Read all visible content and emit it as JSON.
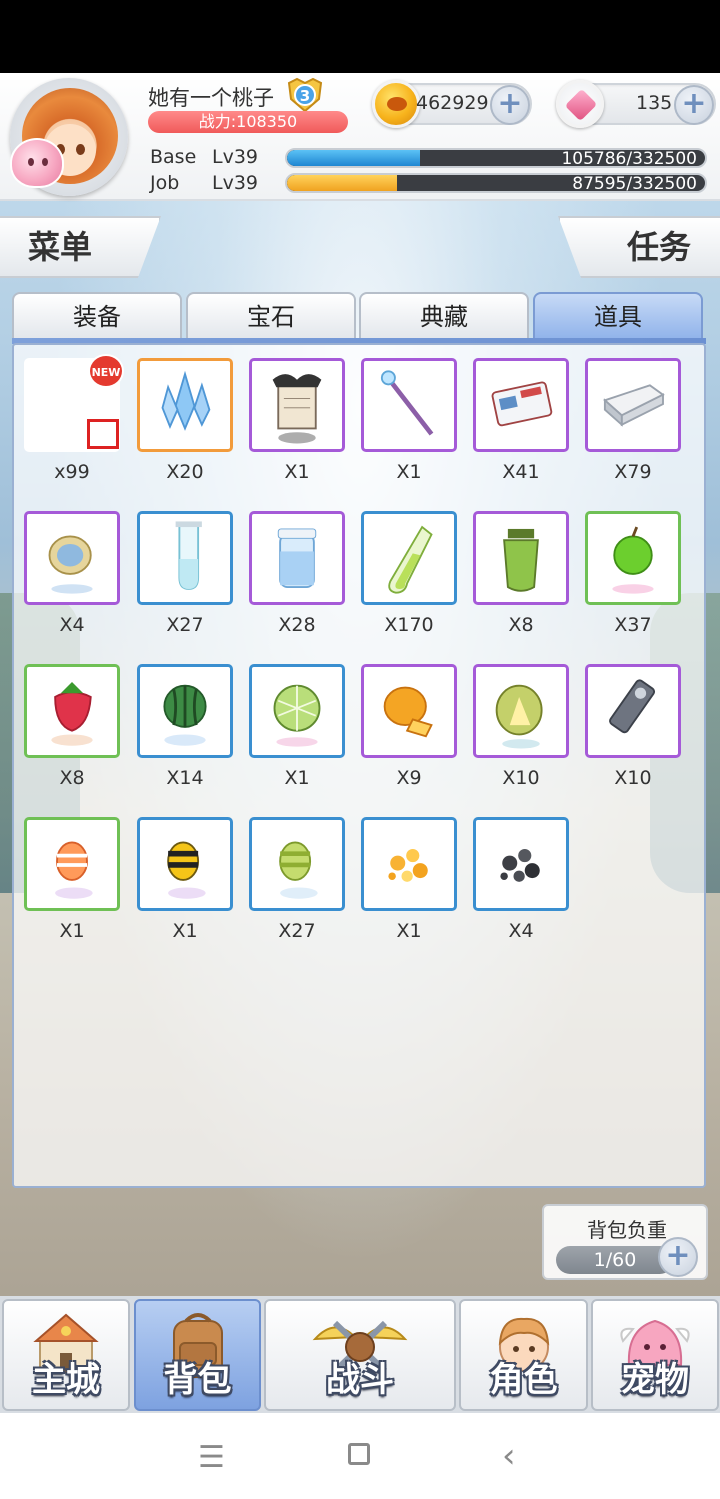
{
  "header": {
    "player_name": "她有一个桃子",
    "rank": "3",
    "power": "战力:108350",
    "gold": "462929",
    "gems": "135",
    "base": {
      "label": "Base",
      "level": "Lv39",
      "progress_text": "105786/332500",
      "progress": 0.318
    },
    "job": {
      "label": "Job",
      "level": "Lv39",
      "progress_text": "87595/332500",
      "progress": 0.263
    }
  },
  "side": {
    "menu_label": "菜单",
    "task_label": "任务"
  },
  "tabs": [
    {
      "label": "装备",
      "active": false
    },
    {
      "label": "宝石",
      "active": false
    },
    {
      "label": "典藏",
      "active": false
    },
    {
      "label": "道具",
      "active": true
    }
  ],
  "inventory": {
    "new_badge": "NEW",
    "items": [
      {
        "icon": "blank-item-icon",
        "qty": "x99",
        "rarity": "none"
      },
      {
        "icon": "ice-crystal-icon",
        "qty": "X20",
        "rarity": "orange"
      },
      {
        "icon": "bat-scroll-icon",
        "qty": "X1",
        "rarity": "purple"
      },
      {
        "icon": "magic-wand-icon",
        "qty": "X1",
        "rarity": "purple"
      },
      {
        "icon": "ticket-icon",
        "qty": "X41",
        "rarity": "purple"
      },
      {
        "icon": "stone-block-icon",
        "qty": "X79",
        "rarity": "purple"
      },
      {
        "icon": "coin-medal-icon",
        "qty": "X4",
        "rarity": "purple"
      },
      {
        "icon": "test-tube-icon",
        "qty": "X27",
        "rarity": "blue"
      },
      {
        "icon": "water-jar-icon",
        "qty": "X28",
        "rarity": "purple"
      },
      {
        "icon": "green-potion-icon",
        "qty": "X170",
        "rarity": "blue"
      },
      {
        "icon": "green-jar-icon",
        "qty": "X8",
        "rarity": "purple"
      },
      {
        "icon": "green-apple-icon",
        "qty": "X37",
        "rarity": "green"
      },
      {
        "icon": "strawberry-icon",
        "qty": "X8",
        "rarity": "green"
      },
      {
        "icon": "watermelon-icon",
        "qty": "X14",
        "rarity": "blue"
      },
      {
        "icon": "melon-icon",
        "qty": "X1",
        "rarity": "blue"
      },
      {
        "icon": "mango-icon",
        "qty": "X9",
        "rarity": "purple"
      },
      {
        "icon": "durian-icon",
        "qty": "X10",
        "rarity": "purple"
      },
      {
        "icon": "crystal-key-icon",
        "qty": "X10",
        "rarity": "purple"
      },
      {
        "icon": "orange-candy-icon",
        "qty": "X1",
        "rarity": "green"
      },
      {
        "icon": "bee-candy-icon",
        "qty": "X1",
        "rarity": "blue"
      },
      {
        "icon": "green-candy-icon",
        "qty": "X27",
        "rarity": "blue"
      },
      {
        "icon": "gold-ore-icon",
        "qty": "X1",
        "rarity": "blue"
      },
      {
        "icon": "dark-ore-icon",
        "qty": "X4",
        "rarity": "blue"
      }
    ]
  },
  "weight": {
    "label": "背包负重",
    "value": "1/60"
  },
  "nav": [
    {
      "label": "主城",
      "icon": "castle-icon",
      "active": false
    },
    {
      "label": "背包",
      "icon": "backpack-icon",
      "active": true
    },
    {
      "label": "战斗",
      "icon": "crossed-swords-icon",
      "active": false
    },
    {
      "label": "角色",
      "icon": "character-icon",
      "active": false
    },
    {
      "label": "宠物",
      "icon": "pet-icon",
      "active": false
    }
  ],
  "colors": {
    "purple": "#a55ad8",
    "blue": "#3a8fd0",
    "green": "#6fc055",
    "orange": "#f29b3b",
    "base_bar": "#2d9be0",
    "job_bar": "#f6b234"
  }
}
